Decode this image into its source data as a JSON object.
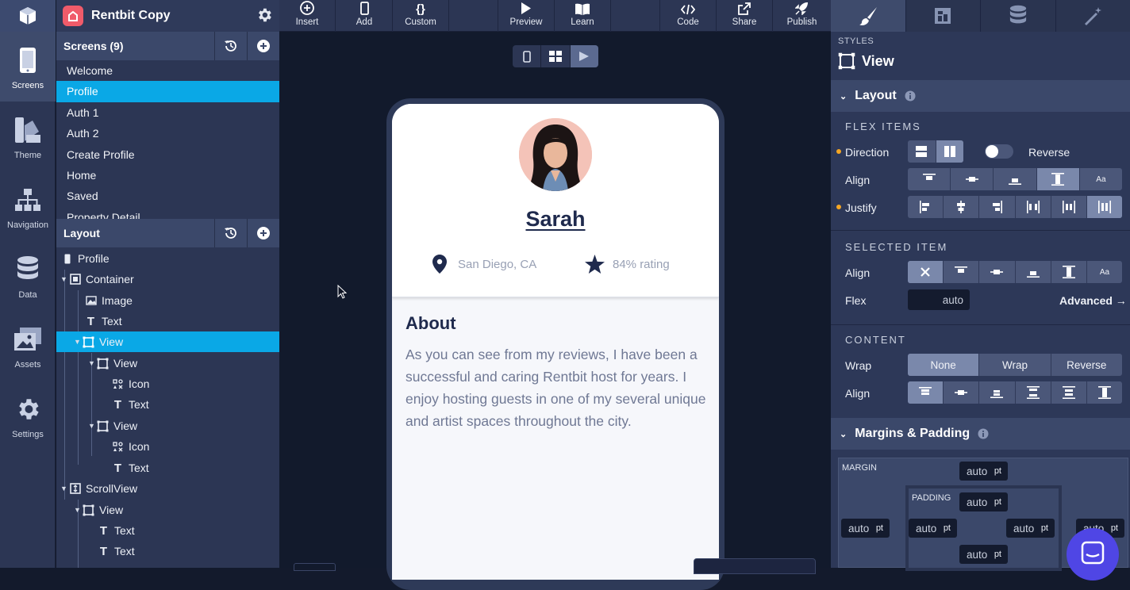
{
  "app": {
    "name": "Rentbit Copy"
  },
  "rail": [
    {
      "label": "Screens",
      "active": true
    },
    {
      "label": "Theme"
    },
    {
      "label": "Navigation"
    },
    {
      "label": "Data"
    },
    {
      "label": "Assets"
    },
    {
      "label": "Settings"
    }
  ],
  "toolbar": {
    "insert": "Insert",
    "add": "Add",
    "custom": "Custom",
    "preview": "Preview",
    "learn": "Learn",
    "code": "Code",
    "share": "Share",
    "publish": "Publish"
  },
  "screens": {
    "title": "Screens (9)",
    "items": [
      "Welcome",
      "Profile",
      "Auth 1",
      "Auth 2",
      "Create Profile",
      "Home",
      "Saved",
      "Property Detail"
    ],
    "selected": "Profile"
  },
  "layout": {
    "title": "Layout",
    "nodes": [
      "Profile",
      "Container",
      "Image",
      "Text",
      "View",
      "View",
      "Icon",
      "Text",
      "View",
      "Icon",
      "Text",
      "ScrollView",
      "View",
      "Text",
      "Text"
    ]
  },
  "preview": {
    "name": "Sarah",
    "location": "San Diego, CA",
    "rating": "84% rating",
    "about_title": "About",
    "about_body": "As you can see from my reviews, I have been a successful and caring Rentbit host for years. I enjoy hosting guests in one of my several unique and artist spaces throughout the city."
  },
  "styles": {
    "label": "STYLES",
    "title": "View",
    "layout_section": "Layout",
    "flex_items": "FLEX ITEMS",
    "direction": "Direction",
    "reverse": "Reverse",
    "align": "Align",
    "justify": "Justify",
    "selected_item": "SELECTED ITEM",
    "flex": "Flex",
    "flex_placeholder": "auto",
    "advanced": "Advanced →",
    "content": "CONTENT",
    "wrap": "Wrap",
    "wrap_options": [
      "None",
      "Wrap",
      "Reverse"
    ],
    "wrap_selected": "None",
    "margins_section": "Margins & Padding",
    "margin": "MARGIN",
    "padding": "PADDING",
    "auto": "auto",
    "unit": "pt",
    "aa": "Aa"
  },
  "colors": {
    "accent": "#0aa8e6",
    "brand": "#f05b6a",
    "orange_dot": "#f5a623"
  }
}
